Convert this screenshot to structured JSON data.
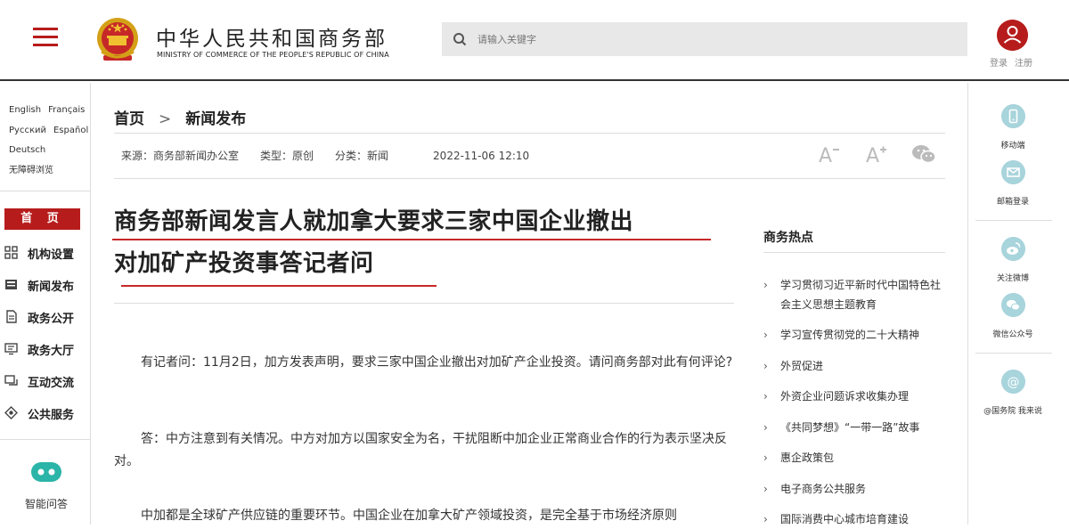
{
  "header": {
    "site_title": "中华人民共和国商务部",
    "site_subtitle": "MINISTRY OF COMMERCE OF THE PEOPLE'S REPUBLIC OF CHINA",
    "search_placeholder": "请输入关键字",
    "login": "登录",
    "register": "注册"
  },
  "languages": {
    "row1": [
      "English",
      "Français"
    ],
    "row2": [
      "Русский",
      "Español"
    ],
    "row3": [
      "Deutsch"
    ],
    "accessible": "无障碍浏览"
  },
  "sidebar": {
    "home": "首 页",
    "items": [
      {
        "label": "机构设置",
        "icon": "grid-icon"
      },
      {
        "label": "新闻发布",
        "icon": "news-icon"
      },
      {
        "label": "政务公开",
        "icon": "document-icon"
      },
      {
        "label": "政务大厅",
        "icon": "monitor-icon"
      },
      {
        "label": "互动交流",
        "icon": "chat-icon"
      },
      {
        "label": "公共服务",
        "icon": "service-icon"
      }
    ],
    "assistant": "智能问答"
  },
  "breadcrumb": {
    "home": "首页",
    "separator": ">",
    "current": "新闻发布"
  },
  "meta": {
    "source": "来源：商务部新闻办公室",
    "type": "类型：原创",
    "category": "分类：新闻",
    "date": "2022-11-06 12:10"
  },
  "article": {
    "title_line1": "商务部新闻发言人就加拿大要求三家中国企业撤出",
    "title_line2": "对加矿产投资事答记者问",
    "paragraphs": [
      "有记者问：11月2日，加方发表声明，要求三家中国企业撤出对加矿产企业投资。请问商务部对此有何评论?",
      "答：中方注意到有关情况。中方对加方以国家安全为名，干扰阻断中加企业正常商业合作的行为表示坚决反对。",
      "中加都是全球矿产供应链的重要环节。中国企业在加拿大矿产领域投资，是完全基于市场经济原则"
    ]
  },
  "hot": {
    "title": "商务热点",
    "items": [
      "学习贯彻习近平新时代中国特色社会主义思想主题教育",
      "学习宣传贯彻党的二十大精神",
      "外贸促进",
      "外资企业问题诉求收集办理",
      "《共同梦想》“一带一路”故事",
      "惠企政策包",
      "电子商务公共服务",
      "国际消费中心城市培育建设"
    ]
  },
  "right_rail": [
    {
      "label": "移动端",
      "icon": "mobile-icon"
    },
    {
      "label": "邮箱登录",
      "icon": "mail-icon"
    },
    {
      "label": "关注微博",
      "icon": "weibo-icon"
    },
    {
      "label": "微信公众号",
      "icon": "wechat-icon"
    },
    {
      "label": "@国务院 我来说",
      "icon": "at-icon"
    }
  ],
  "colors": {
    "brand_red": "#b71c1c",
    "underline_red": "#c62828",
    "rail_icon": "#a8d4dc"
  }
}
